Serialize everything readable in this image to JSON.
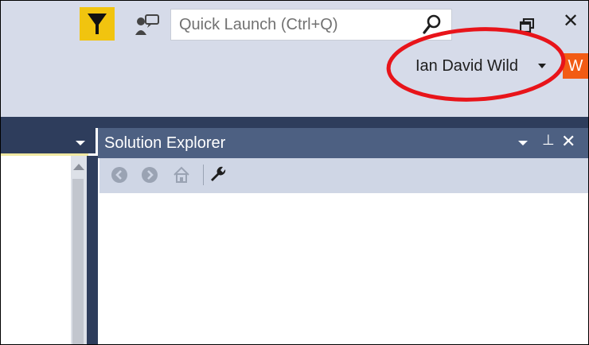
{
  "toolbar": {
    "quick_launch_placeholder": "Quick Launch (Ctrl+Q)",
    "close_glyph": "✕"
  },
  "account": {
    "name": "Ian David Wild",
    "office_badge": "W"
  },
  "solution_explorer": {
    "title": "Solution Explorer",
    "pin_glyph": "⊥",
    "close_glyph": "✕"
  },
  "colors": {
    "chrome_bg": "#d6dbe9",
    "filter_accent": "#f1c40f",
    "office_badge": "#f25b14",
    "panel_header": "#4d6082",
    "dark_bar": "#2e3d5c",
    "annotation_ellipse": "#e8141a"
  },
  "icons": [
    "filter-icon",
    "feedback-icon",
    "search-icon",
    "restore-window-icon",
    "close-icon",
    "back-icon",
    "forward-icon",
    "home-icon",
    "properties-wrench-icon",
    "pin-icon",
    "chevron-down-icon"
  ]
}
